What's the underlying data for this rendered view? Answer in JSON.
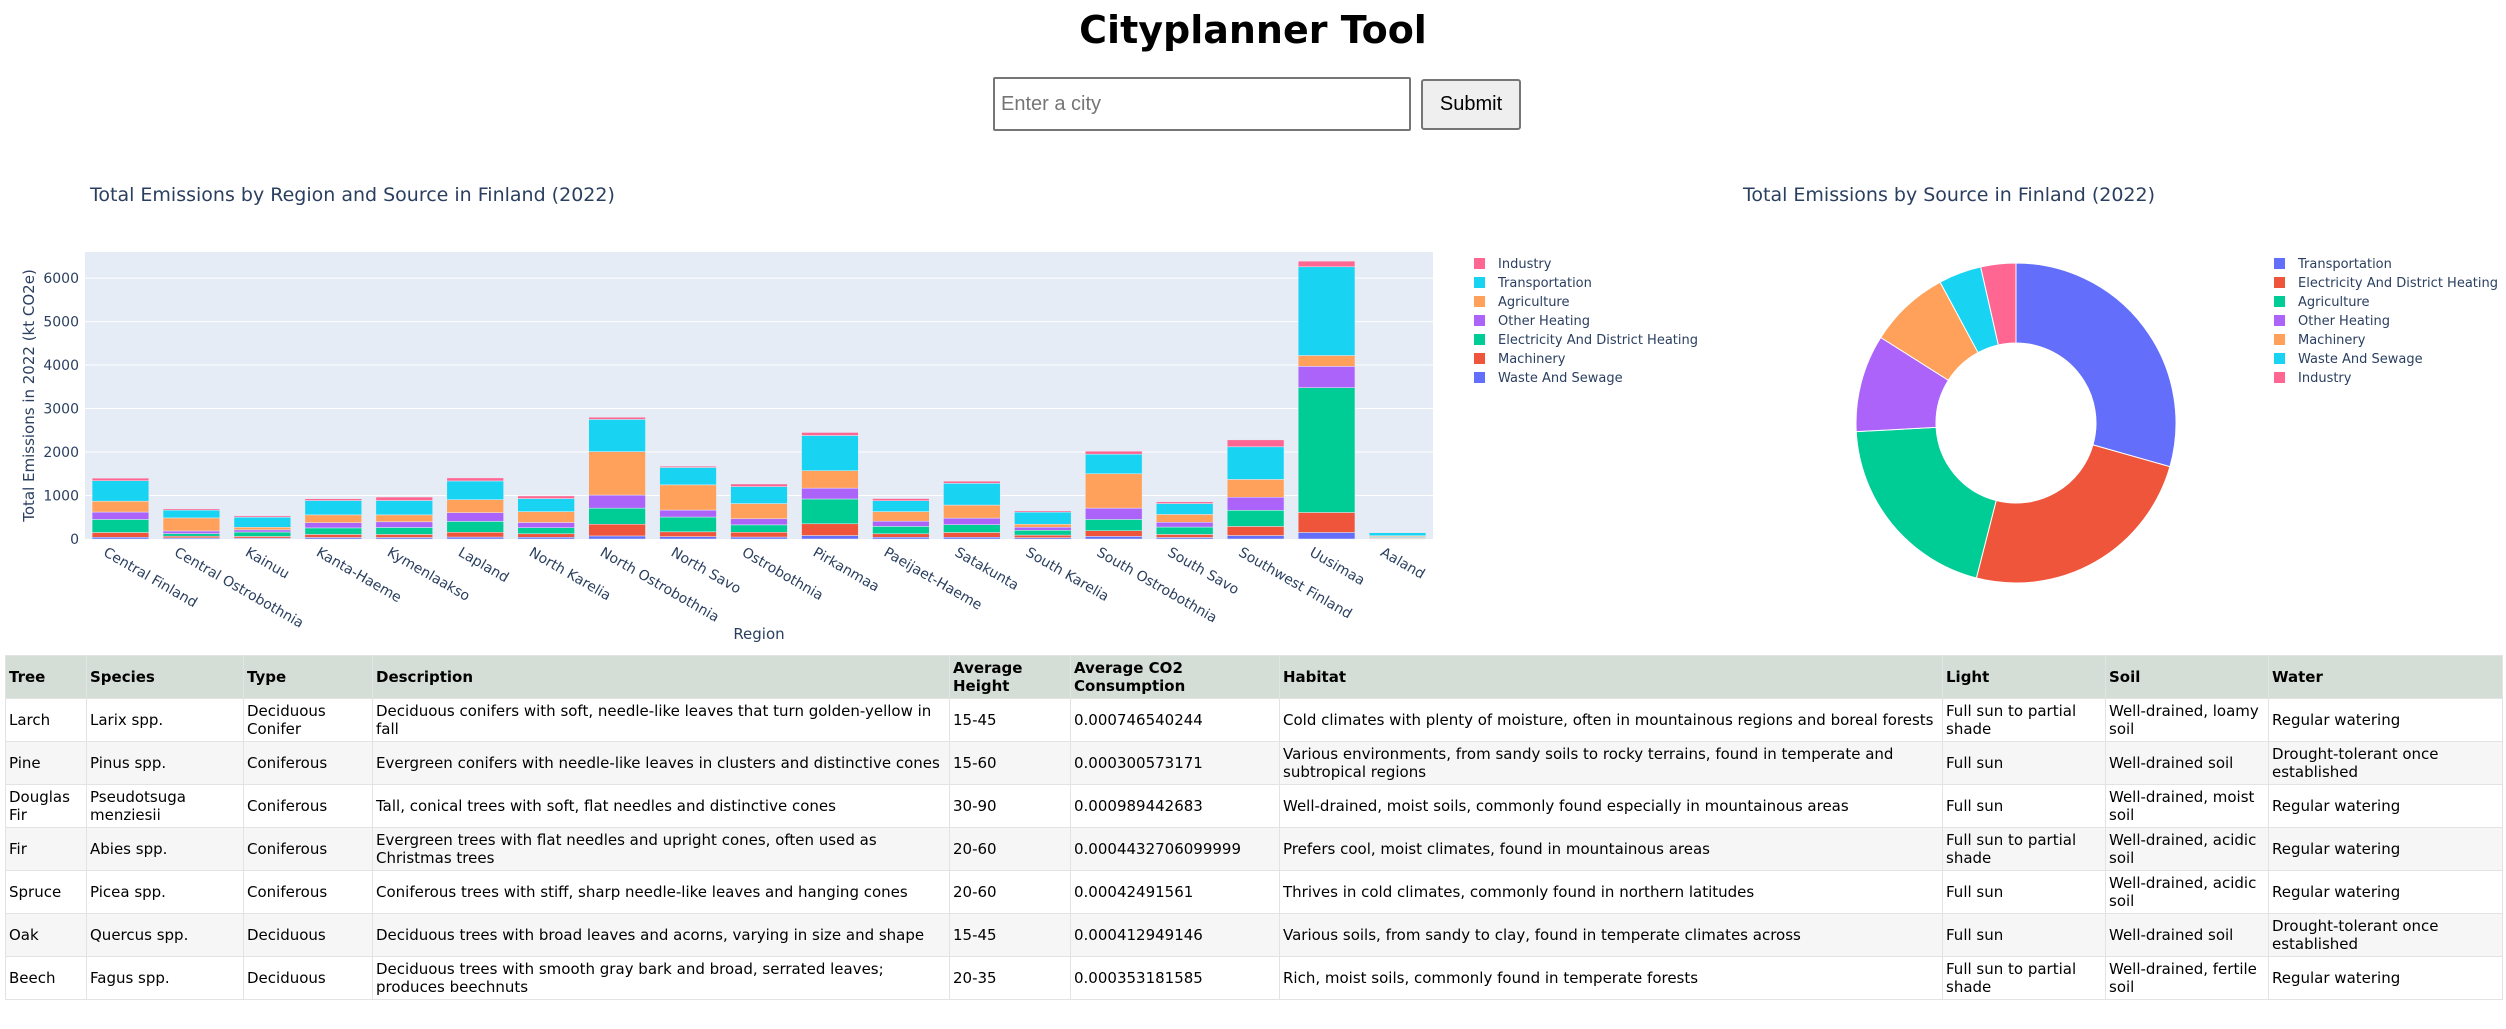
{
  "page_title": "Cityplanner Tool",
  "search": {
    "placeholder": "Enter a city",
    "value": "",
    "submit_label": "Submit"
  },
  "bar_chart": {
    "title": "Total Emissions by Region and Source in Finland (2022)",
    "xlabel": "Region",
    "ylabel": "Total Emissions in 2022 (kt CO2e)"
  },
  "pie_chart": {
    "title": "Total Emissions by Source in Finland (2022)"
  },
  "chart_data": [
    {
      "type": "bar",
      "stacked": true,
      "title": "Total Emissions by Region and Source in Finland (2022)",
      "xlabel": "Region",
      "ylabel": "Total Emissions in 2022 (kt CO2e)",
      "ylim": [
        0,
        6600
      ],
      "yticks": [
        0,
        1000,
        2000,
        3000,
        4000,
        5000,
        6000
      ],
      "ytick_labels": [
        "0",
        "1000",
        "2000",
        "3000",
        "4000",
        "5000",
        "6000"
      ],
      "grid": true,
      "legend_position": "right",
      "categories": [
        "Central Finland",
        "Central Ostrobothnia",
        "Kainuu",
        "Kanta-Haeme",
        "Kymenlaakso",
        "Lapland",
        "North Karelia",
        "North Ostrobothnia",
        "North Savo",
        "Ostrobothnia",
        "Pirkanmaa",
        "Paeijaet-Haeme",
        "Satakunta",
        "South Karelia",
        "South Ostrobothnia",
        "South Savo",
        "Southwest Finland",
        "Uusimaa",
        "Aaland"
      ],
      "series": [
        {
          "name": "Waste And Sewage",
          "color": "#636efa",
          "values": [
            40,
            25,
            20,
            35,
            35,
            45,
            40,
            70,
            55,
            45,
            80,
            40,
            40,
            30,
            60,
            35,
            80,
            150,
            10
          ]
        },
        {
          "name": "Machinery",
          "color": "#ef553b",
          "values": [
            110,
            40,
            40,
            70,
            70,
            110,
            80,
            270,
            110,
            110,
            270,
            80,
            110,
            60,
            130,
            70,
            210,
            460,
            15
          ]
        },
        {
          "name": "Electricity And District Heating",
          "color": "#00cc96",
          "values": [
            300,
            60,
            100,
            150,
            160,
            250,
            140,
            370,
            340,
            170,
            570,
            170,
            180,
            110,
            260,
            170,
            370,
            2870,
            20
          ]
        },
        {
          "name": "Other Heating",
          "color": "#ab63fa",
          "values": [
            170,
            60,
            50,
            120,
            130,
            200,
            120,
            300,
            160,
            140,
            250,
            120,
            150,
            70,
            260,
            110,
            300,
            490,
            10
          ]
        },
        {
          "name": "Agriculture",
          "color": "#ffa15a",
          "values": [
            250,
            300,
            60,
            180,
            160,
            300,
            250,
            1000,
            580,
            350,
            400,
            220,
            300,
            70,
            790,
            180,
            410,
            250,
            20
          ]
        },
        {
          "name": "Transportation",
          "color": "#19d3f3",
          "values": [
            470,
            180,
            230,
            330,
            330,
            430,
            300,
            740,
            400,
            390,
            810,
            250,
            500,
            280,
            450,
            250,
            750,
            2040,
            70
          ]
        },
        {
          "name": "Industry",
          "color": "#ff6692",
          "values": [
            60,
            30,
            30,
            40,
            80,
            70,
            60,
            50,
            30,
            60,
            70,
            50,
            50,
            30,
            70,
            40,
            160,
            130,
            10
          ]
        }
      ]
    },
    {
      "type": "pie",
      "hole": true,
      "title": "Total Emissions by Source in Finland (2022)",
      "legend_position": "right",
      "labels": [
        "Transportation",
        "Electricity And District Heating",
        "Agriculture",
        "Other Heating",
        "Machinery",
        "Waste And Sewage",
        "Industry"
      ],
      "colors": [
        "#636efa",
        "#ef553b",
        "#00cc96",
        "#ab63fa",
        "#ffa15a",
        "#19d3f3",
        "#ff6692"
      ],
      "values": [
        29.9,
        25.0,
        20.5,
        10.0,
        8.3,
        4.4,
        3.6
      ]
    }
  ],
  "tree_table": {
    "headers": [
      "Tree",
      "Species",
      "Type",
      "Description",
      "Average Height",
      "Average CO2 Consumption",
      "Habitat",
      "Light",
      "Soil",
      "Water"
    ],
    "rows": [
      [
        "Larch",
        "Larix spp.",
        "Deciduous Conifer",
        "Deciduous conifers with soft, needle-like leaves that turn golden-yellow in fall",
        "15-45",
        "0.000746540244",
        "Cold climates with plenty of moisture, often in mountainous regions and boreal forests",
        "Full sun to partial shade",
        "Well-drained, loamy soil",
        "Regular watering"
      ],
      [
        "Pine",
        "Pinus spp.",
        "Coniferous",
        "Evergreen conifers with needle-like leaves in clusters and distinctive cones",
        "15-60",
        "0.000300573171",
        "Various environments, from sandy soils to rocky terrains, found in temperate and subtropical regions",
        "Full sun",
        "Well-drained soil",
        "Drought-tolerant once established"
      ],
      [
        "Douglas Fir",
        "Pseudotsuga menziesii",
        "Coniferous",
        "Tall, conical trees with soft, flat needles and distinctive cones",
        "30-90",
        "0.000989442683",
        "Well-drained, moist soils, commonly found especially in mountainous areas",
        "Full sun",
        "Well-drained, moist soil",
        "Regular watering"
      ],
      [
        "Fir",
        "Abies spp.",
        "Coniferous",
        "Evergreen trees with flat needles and upright cones, often used as Christmas trees",
        "20-60",
        "0.0004432706099999",
        "Prefers cool, moist climates, found in mountainous areas",
        "Full sun to partial shade",
        "Well-drained, acidic soil",
        "Regular watering"
      ],
      [
        "Spruce",
        "Picea spp.",
        "Coniferous",
        "Coniferous trees with stiff, sharp needle-like leaves and hanging cones",
        "20-60",
        "0.00042491561",
        "Thrives in cold climates, commonly found in northern latitudes",
        "Full sun",
        "Well-drained, acidic soil",
        "Regular watering"
      ],
      [
        "Oak",
        "Quercus spp.",
        "Deciduous",
        "Deciduous trees with broad leaves and acorns, varying in size and shape",
        "15-45",
        "0.000412949146",
        "Various soils, from sandy to clay, found in temperate climates across",
        "Full sun",
        "Well-drained soil",
        "Drought-tolerant once established"
      ],
      [
        "Beech",
        "Fagus spp.",
        "Deciduous",
        "Deciduous trees with smooth gray bark and broad, serrated leaves; produces beechnuts",
        "20-35",
        "0.000353181585",
        "Rich, moist soils, commonly found in temperate forests",
        "Full sun to partial shade",
        "Well-drained, fertile soil",
        "Regular watering"
      ]
    ]
  }
}
